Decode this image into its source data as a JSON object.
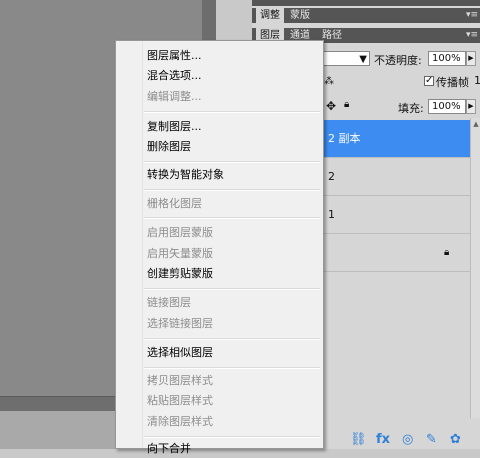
{
  "panel": {
    "tabs_top": [
      "调整",
      "蒙版"
    ],
    "tabs_layers": [
      "图层",
      "通道",
      "路径"
    ],
    "opacity_label": "不透明度:",
    "opacity_value": "100%",
    "propagate_label": "传播帧",
    "propagate_suffix": "1",
    "fill_label": "填充:",
    "fill_value": "100%",
    "layers": [
      {
        "name": "2 副本",
        "selected": true
      },
      {
        "name": "2",
        "selected": false
      },
      {
        "name": "1",
        "selected": false
      },
      {
        "name": "",
        "locked": true
      }
    ]
  },
  "context_menu": {
    "items": [
      {
        "label": "图层属性...",
        "enabled": true
      },
      {
        "label": "混合选项...",
        "enabled": true
      },
      {
        "label": "编辑调整...",
        "enabled": false
      },
      {
        "label": "复制图层...",
        "enabled": true
      },
      {
        "label": "删除图层",
        "enabled": true
      },
      {
        "label": "转换为智能对象",
        "enabled": true
      },
      {
        "label": "栅格化图层",
        "enabled": false
      },
      {
        "label": "启用图层蒙版",
        "enabled": false
      },
      {
        "label": "启用矢量蒙版",
        "enabled": false
      },
      {
        "label": "创建剪贴蒙版",
        "enabled": true
      },
      {
        "label": "链接图层",
        "enabled": false
      },
      {
        "label": "选择链接图层",
        "enabled": false
      },
      {
        "label": "选择相似图层",
        "enabled": true
      },
      {
        "label": "拷贝图层样式",
        "enabled": false
      },
      {
        "label": "粘贴图层样式",
        "enabled": false
      },
      {
        "label": "清除图层样式",
        "enabled": false
      },
      {
        "label": "向下合并",
        "enabled": true
      }
    ]
  },
  "icons": [
    "move-icon",
    "lock-icon",
    "link-icon",
    "fx-icon",
    "mask-icon",
    "brush-icon",
    "gear-icon",
    "chevron-down-icon",
    "arrow-right-icon"
  ]
}
